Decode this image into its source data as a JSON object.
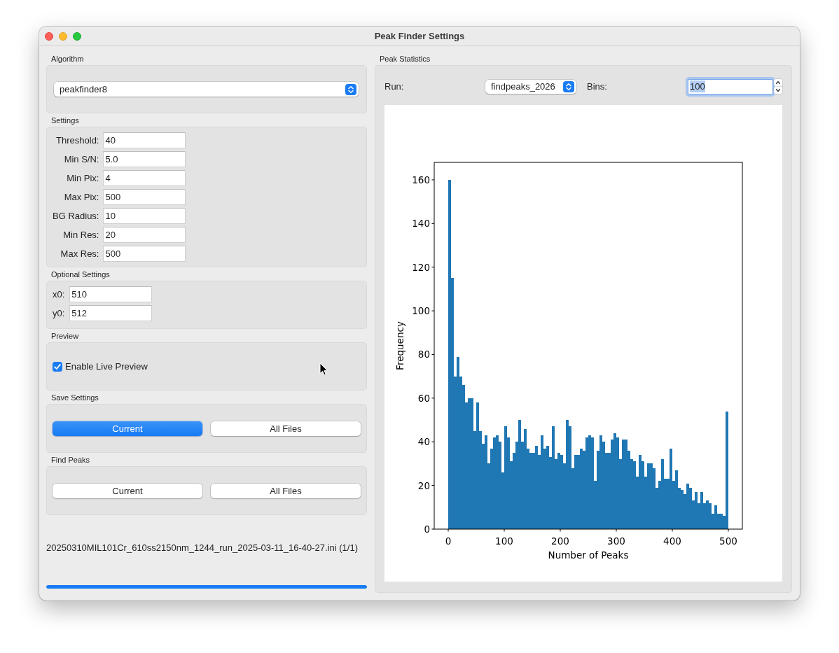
{
  "window": {
    "title": "Peak Finder Settings"
  },
  "algorithm": {
    "title": "Algorithm",
    "value": "peakfinder8"
  },
  "settings": {
    "title": "Settings",
    "fields": [
      {
        "label": "Threshold:",
        "value": "40"
      },
      {
        "label": "Min S/N:",
        "value": "5.0"
      },
      {
        "label": "Min Pix:",
        "value": "4"
      },
      {
        "label": "Max Pix:",
        "value": "500"
      },
      {
        "label": "BG Radius:",
        "value": "10"
      },
      {
        "label": "Min Res:",
        "value": "20"
      },
      {
        "label": "Max Res:",
        "value": "500"
      }
    ]
  },
  "optional_settings": {
    "title": "Optional Settings",
    "fields": [
      {
        "label": "x0:",
        "value": "510"
      },
      {
        "label": "y0:",
        "value": "512"
      }
    ]
  },
  "preview": {
    "title": "Preview",
    "checkbox": {
      "label": "Enable Live Preview",
      "checked": true
    }
  },
  "save_settings": {
    "title": "Save Settings",
    "buttons": [
      {
        "label": "Current",
        "default": true
      },
      {
        "label": "All Files",
        "default": false
      }
    ]
  },
  "find_peaks": {
    "title": "Find Peaks",
    "buttons": [
      {
        "label": "Current",
        "default": false
      },
      {
        "label": "All Files",
        "default": false
      }
    ]
  },
  "status": {
    "file": "20250310MIL101Cr_610ss2150nm_1244_run_2025-03-11_16-40-27.ini (1/1)",
    "progress": {
      "level": 1
    }
  },
  "peak_statistics": {
    "title": "Peak Statistics",
    "run": {
      "label": "Run:",
      "value": "findpeaks_2026"
    },
    "bins": {
      "label": "Bins:",
      "value": "100",
      "focused": true,
      "text_selected": true
    },
    "chart_data": {
      "type": "bar",
      "xlabel": "Number of Peaks",
      "ylabel": "Frequency",
      "x": [
        2.5,
        7.5,
        12.5,
        17.5,
        22.5,
        27.5,
        32.5,
        37.5,
        42.5,
        47.5,
        52.5,
        57.5,
        62.5,
        67.5,
        72.5,
        77.5,
        82.5,
        87.5,
        92.5,
        97.5,
        102.5,
        107.5,
        112.5,
        117.5,
        122.5,
        127.5,
        132.5,
        137.5,
        142.5,
        147.5,
        152.5,
        157.5,
        162.5,
        167.5,
        172.5,
        177.5,
        182.5,
        187.5,
        192.5,
        197.5,
        202.5,
        207.5,
        212.5,
        217.5,
        222.5,
        227.5,
        232.5,
        237.5,
        242.5,
        247.5,
        252.5,
        257.5,
        262.5,
        267.5,
        272.5,
        277.5,
        282.5,
        287.5,
        292.5,
        297.5,
        302.5,
        307.5,
        312.5,
        317.5,
        322.5,
        327.5,
        332.5,
        337.5,
        342.5,
        347.5,
        352.5,
        357.5,
        362.5,
        367.5,
        372.5,
        377.5,
        382.5,
        387.5,
        392.5,
        397.5,
        402.5,
        407.5,
        412.5,
        417.5,
        422.5,
        427.5,
        432.5,
        437.5,
        442.5,
        447.5,
        452.5,
        457.5,
        462.5,
        467.5,
        472.5,
        477.5,
        482.5,
        487.5,
        492.5,
        497.5
      ],
      "values": [
        160,
        115,
        70,
        79,
        70,
        66,
        58,
        60,
        60,
        45,
        58,
        45,
        39,
        43,
        30,
        37,
        42,
        43,
        40,
        26,
        47,
        42,
        31,
        35,
        40,
        50,
        40,
        46,
        37,
        35,
        35,
        38,
        34,
        43,
        37,
        38,
        33,
        47,
        32,
        35,
        34,
        30,
        50,
        47,
        28,
        34,
        34,
        37,
        36,
        42,
        43,
        42,
        22,
        36,
        43,
        40,
        35,
        35,
        41,
        44,
        42,
        32,
        41,
        41,
        36,
        32,
        31,
        24,
        34,
        31,
        24,
        30,
        30,
        28,
        19,
        22,
        32,
        23,
        23,
        37,
        22,
        27,
        19,
        18,
        16,
        21,
        19,
        13,
        17,
        12,
        17,
        12,
        13,
        12,
        7,
        11,
        7,
        7,
        6,
        54
      ],
      "xlim": [
        -25,
        525
      ],
      "ylim": [
        0,
        168
      ],
      "xticks": [
        0,
        100,
        200,
        300,
        400,
        500
      ],
      "yticks": [
        0,
        20,
        40,
        60,
        80,
        100,
        120,
        140,
        160
      ]
    }
  }
}
